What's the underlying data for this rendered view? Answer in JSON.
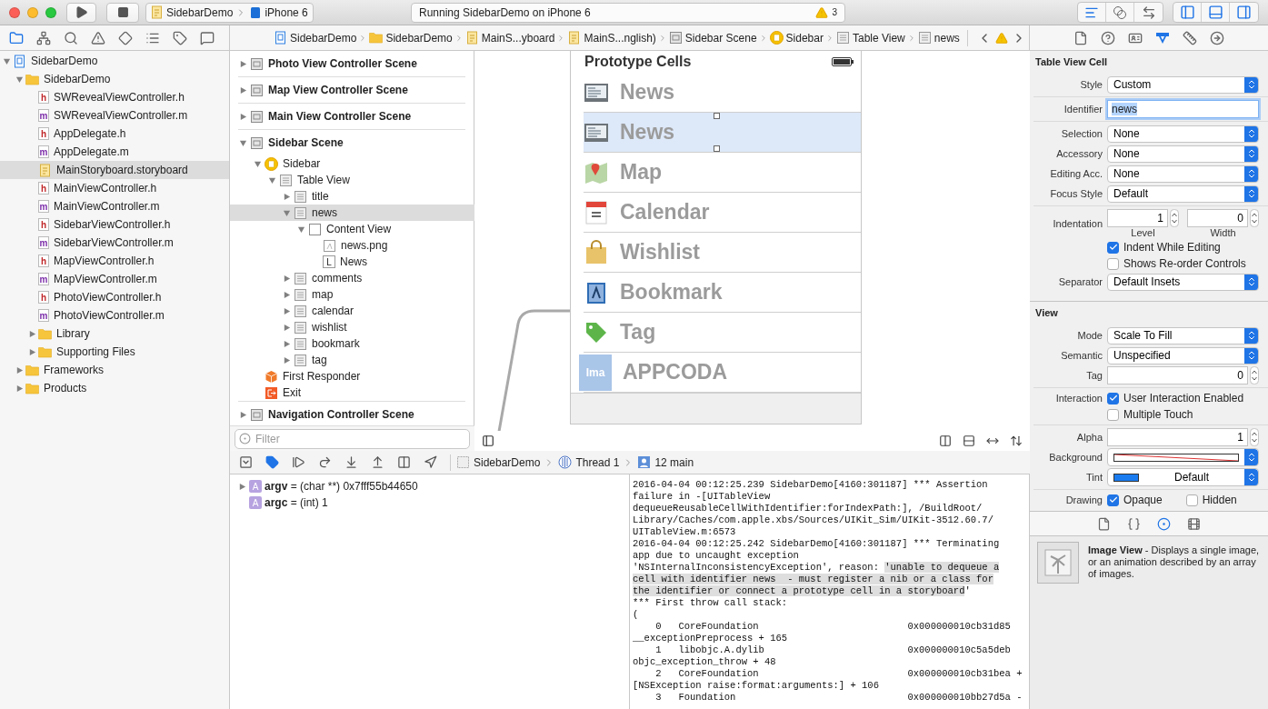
{
  "toolbar": {
    "scheme": "SidebarDemo",
    "device": "iPhone 6",
    "status": "Running SidebarDemo on iPhone 6",
    "warning_count": "3",
    "editor_modes": [
      {
        "kind": "standard",
        "selected": true
      },
      {
        "kind": "assistant",
        "selected": false
      },
      {
        "kind": "version",
        "selected": false
      }
    ],
    "panels": [
      {
        "kind": "navigator",
        "on": true
      },
      {
        "kind": "debug",
        "on": true
      },
      {
        "kind": "utilities",
        "on": true
      }
    ]
  },
  "navigator_tabs": [
    {
      "kind": "project",
      "selected": true
    },
    {
      "kind": "symbol",
      "selected": false
    },
    {
      "kind": "find",
      "selected": false
    },
    {
      "kind": "issue",
      "selected": false
    },
    {
      "kind": "test",
      "selected": false
    },
    {
      "kind": "debug",
      "selected": false
    },
    {
      "kind": "breakpoint",
      "selected": false
    },
    {
      "kind": "report",
      "selected": false
    }
  ],
  "jump_bar": [
    {
      "kind": "project",
      "label": "SidebarDemo"
    },
    {
      "kind": "folder",
      "label": "SidebarDemo"
    },
    {
      "kind": "storyboard",
      "label": "MainS...yboard"
    },
    {
      "kind": "storyboard",
      "label": "MainS...nglish)"
    },
    {
      "kind": "scene",
      "label": "Sidebar Scene"
    },
    {
      "kind": "controller",
      "label": "Sidebar"
    },
    {
      "kind": "table",
      "label": "Table View"
    },
    {
      "kind": "table",
      "label": "news"
    }
  ],
  "inspector_tabs": [
    {
      "kind": "file",
      "selected": false
    },
    {
      "kind": "help",
      "selected": false
    },
    {
      "kind": "identity",
      "selected": false
    },
    {
      "kind": "attributes",
      "selected": true
    },
    {
      "kind": "size",
      "selected": false
    },
    {
      "kind": "connections",
      "selected": false
    }
  ],
  "navigator": {
    "tree": [
      {
        "kind": "project",
        "label": "SidebarDemo",
        "expanded": true,
        "selected": false,
        "children": [
          {
            "kind": "folder",
            "label": "SidebarDemo",
            "expanded": true,
            "selected": false,
            "children": [
              {
                "kind": "header",
                "badge": "h",
                "label": "SWRevealViewController.h",
                "selected": false
              },
              {
                "kind": "source",
                "badge": "m",
                "label": "SWRevealViewController.m",
                "selected": false
              },
              {
                "kind": "header",
                "badge": "h",
                "label": "AppDelegate.h",
                "selected": false
              },
              {
                "kind": "source",
                "badge": "m",
                "label": "AppDelegate.m",
                "selected": false
              },
              {
                "kind": "storyboard",
                "label": "MainStoryboard.storyboard",
                "selected": true
              },
              {
                "kind": "header",
                "badge": "h",
                "label": "MainViewController.h",
                "selected": false
              },
              {
                "kind": "source",
                "badge": "m",
                "label": "MainViewController.m",
                "selected": false
              },
              {
                "kind": "header",
                "badge": "h",
                "label": "SidebarViewController.h",
                "selected": false
              },
              {
                "kind": "source",
                "badge": "m",
                "label": "SidebarViewController.m",
                "selected": false
              },
              {
                "kind": "header",
                "badge": "h",
                "label": "MapViewController.h",
                "selected": false
              },
              {
                "kind": "source",
                "badge": "m",
                "label": "MapViewController.m",
                "selected": false
              },
              {
                "kind": "header",
                "badge": "h",
                "label": "PhotoViewController.h",
                "selected": false
              },
              {
                "kind": "source",
                "badge": "m",
                "label": "PhotoViewController.m",
                "selected": false
              },
              {
                "kind": "folder",
                "label": "Library",
                "expanded": false,
                "selected": false
              },
              {
                "kind": "folder",
                "label": "Supporting Files",
                "expanded": false,
                "selected": false
              }
            ]
          },
          {
            "kind": "folder",
            "label": "Frameworks",
            "expanded": false,
            "selected": false
          },
          {
            "kind": "folder",
            "label": "Products",
            "expanded": false,
            "selected": false
          }
        ]
      }
    ]
  },
  "outline": {
    "scenes": [
      {
        "label": "Photo View Controller Scene",
        "expanded": false
      },
      {
        "label": "Map View Controller Scene",
        "expanded": false
      },
      {
        "label": "Main View Controller Scene",
        "expanded": false
      },
      {
        "label": "Sidebar Scene",
        "expanded": true,
        "children": [
          {
            "kind": "controller",
            "label": "Sidebar",
            "expanded": true,
            "selected": false,
            "children": [
              {
                "kind": "table",
                "label": "Table View",
                "expanded": true,
                "selected": false,
                "children": [
                  {
                    "kind": "cell",
                    "label": "title",
                    "expanded": false,
                    "selected": false
                  },
                  {
                    "kind": "cell",
                    "label": "news",
                    "expanded": true,
                    "selected": true,
                    "children": [
                      {
                        "kind": "view",
                        "label": "Content View",
                        "expanded": true,
                        "selected": false,
                        "children": [
                          {
                            "kind": "image",
                            "label": "news.png",
                            "selected": false
                          },
                          {
                            "kind": "label",
                            "badge": "L",
                            "label": "News",
                            "selected": false
                          }
                        ]
                      }
                    ]
                  },
                  {
                    "kind": "cell",
                    "label": "comments",
                    "expanded": false,
                    "selected": false
                  },
                  {
                    "kind": "cell",
                    "label": "map",
                    "expanded": false,
                    "selected": false
                  },
                  {
                    "kind": "cell",
                    "label": "calendar",
                    "expanded": false,
                    "selected": false
                  },
                  {
                    "kind": "cell",
                    "label": "wishlist",
                    "expanded": false,
                    "selected": false
                  },
                  {
                    "kind": "cell",
                    "label": "bookmark",
                    "expanded": false,
                    "selected": false
                  },
                  {
                    "kind": "cell",
                    "label": "tag",
                    "expanded": false,
                    "selected": false
                  }
                ]
              }
            ]
          },
          {
            "kind": "responder",
            "label": "First Responder",
            "selected": false
          },
          {
            "kind": "exit",
            "label": "Exit",
            "selected": false
          }
        ]
      },
      {
        "label": "Navigation Controller Scene",
        "expanded": false
      }
    ],
    "filter_placeholder": "Filter"
  },
  "canvas": {
    "title": "Prototype Cells",
    "cells": [
      {
        "kind": "news",
        "label": "News",
        "selected": false
      },
      {
        "kind": "news",
        "label": "News",
        "selected": true
      },
      {
        "kind": "map",
        "label": "Map",
        "selected": false
      },
      {
        "kind": "calendar",
        "label": "Calendar",
        "selected": false
      },
      {
        "kind": "wishlist",
        "label": "Wishlist",
        "selected": false
      },
      {
        "kind": "bookmark",
        "label": "Bookmark",
        "selected": false
      },
      {
        "kind": "tag",
        "label": "Tag",
        "selected": false
      },
      {
        "kind": "placeholder",
        "badge": "Ima",
        "label": "APPCODA",
        "selected": false
      }
    ]
  },
  "debug": {
    "breakpoints_on": true,
    "path": [
      {
        "kind": "app",
        "label": "SidebarDemo"
      },
      {
        "kind": "thread",
        "label": "Thread 1"
      },
      {
        "kind": "frame",
        "label": "12 main"
      }
    ]
  },
  "variables": [
    {
      "badge": "A",
      "text": "**argv** = (char **) 0x7fff55b44650",
      "expanded": false
    },
    {
      "badge": "A",
      "text": "**argc** = (int) 1"
    }
  ],
  "console": [
    {
      "text": "2016-04-04 00:12:25.239 SidebarDemo[4160:301187] *** Assertion"
    },
    {
      "text": "failure in -[UITableView"
    },
    {
      "text": "dequeueReusableCellWithIdentifier:forIndexPath:], /BuildRoot/"
    },
    {
      "text": "Library/Caches/com.apple.xbs/Sources/UIKit_Sim/UIKit-3512.60.7/"
    },
    {
      "text": "UITableView.m:6573"
    },
    {
      "text": "2016-04-04 00:12:25.242 SidebarDemo[4160:301187] *** Terminating"
    },
    {
      "text": "app due to uncaught exception"
    },
    {
      "parts": [
        {
          "text": "'NSInternalInconsistencyException', reason: ",
          "highlighted": false
        },
        {
          "text": "'unable to dequeue a",
          "highlighted": true
        }
      ]
    },
    {
      "parts": [
        {
          "text": "cell with identifier news  - must register a nib or a class for",
          "highlighted": true
        }
      ]
    },
    {
      "parts": [
        {
          "text": "the identifier or connect a prototype cell in a storyboard",
          "highlighted": true
        },
        {
          "text": "'",
          "highlighted": false
        }
      ]
    },
    {
      "text": "*** First throw call stack:"
    },
    {
      "text": "("
    },
    {
      "text": "    0   CoreFoundation                          0x000000010cb31d85"
    },
    {
      "text": "__exceptionPreprocess + 165"
    },
    {
      "text": "    1   libobjc.A.dylib                         0x000000010c5a5deb"
    },
    {
      "text": "objc_exception_throw + 48"
    },
    {
      "text": "    2   CoreFoundation                          0x000000010cb31bea +"
    },
    {
      "text": "[NSException raise:format:arguments:] + 106"
    },
    {
      "text": "    3   Foundation                              0x000000010bb27d5a -"
    }
  ],
  "inspector": {
    "sections": [
      {
        "title": "Table View Cell",
        "groups": [
          {
            "rows": [
              {
                "kind": "popup",
                "label": "Style",
                "value": "Custom"
              }
            ]
          },
          {
            "rows": [
              {
                "kind": "text",
                "label": "Identifier",
                "value": "news",
                "focused": true
              }
            ]
          },
          {
            "rows": [
              {
                "kind": "popup",
                "label": "Selection",
                "value": "None"
              },
              {
                "kind": "popup",
                "label": "Accessory",
                "value": "None"
              },
              {
                "kind": "popup",
                "label": "Editing Acc.",
                "value": "None"
              },
              {
                "kind": "popup",
                "label": "Focus Style",
                "value": "Default"
              }
            ]
          },
          {
            "rows": [
              {
                "kind": "steppers",
                "label": "Indentation",
                "fields": [
                  {
                    "value": "1",
                    "caption": "Level"
                  },
                  {
                    "value": "0",
                    "caption": "Width"
                  }
                ]
              },
              {
                "kind": "checkbox",
                "text": "Indent While Editing",
                "checked": true
              },
              {
                "kind": "checkbox",
                "text": "Shows Re-order Controls",
                "checked": false
              },
              {
                "kind": "popup",
                "label": "Separator",
                "value": "Default Insets"
              }
            ]
          }
        ]
      },
      {
        "title": "View",
        "groups": [
          {
            "rows": [
              {
                "kind": "popup",
                "label": "Mode",
                "value": "Scale To Fill"
              },
              {
                "kind": "popup",
                "label": "Semantic",
                "value": "Unspecified"
              },
              {
                "kind": "number",
                "label": "Tag",
                "value": "0"
              }
            ]
          },
          {
            "rows": [
              {
                "kind": "checkbox",
                "label": "Interaction",
                "text": "User Interaction Enabled",
                "checked": true
              },
              {
                "kind": "checkbox",
                "text": "Multiple Touch",
                "checked": false
              }
            ]
          },
          {
            "rows": [
              {
                "kind": "number",
                "label": "Alpha",
                "value": "1"
              },
              {
                "kind": "color",
                "label": "Background",
                "clear": true
              },
              {
                "kind": "color",
                "label": "Tint",
                "color": "#1b7cf0",
                "value": "Default",
                "clear": false
              }
            ]
          },
          {
            "rows": [
              {
                "kind": "checkboxes",
                "label": "Drawing",
                "items": [
                  {
                    "text": "Opaque",
                    "checked": true
                  },
                  {
                    "text": "Hidden",
                    "checked": false
                  }
                ]
              }
            ]
          }
        ]
      }
    ]
  },
  "library": {
    "tabs": [
      {
        "kind": "file",
        "selected": false
      },
      {
        "kind": "code",
        "selected": false
      },
      {
        "kind": "object",
        "selected": true
      },
      {
        "kind": "media",
        "selected": false
      }
    ],
    "item": {
      "text": "**Image View** - Displays a single image, or an animation described by an array of images."
    }
  }
}
